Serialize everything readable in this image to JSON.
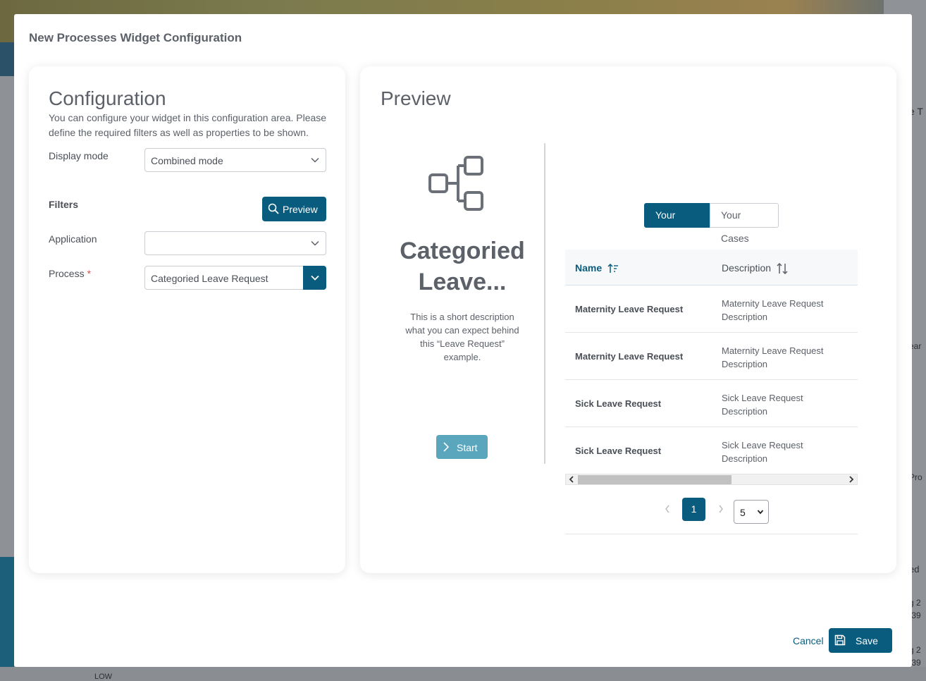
{
  "modal": {
    "title": "New Processes Widget Configuration",
    "cancel_label": "Cancel",
    "save_label": "Save"
  },
  "config": {
    "heading": "Configuration",
    "description": "You can configure your widget in this configuration area. Please define the required filters as well as properties to be shown.",
    "display_mode_label": "Display mode",
    "display_mode_value": "Combined mode",
    "filters_label": "Filters",
    "preview_button": "Preview",
    "application_label": "Application",
    "application_value": "",
    "process_label": "Process",
    "process_required_mark": "*",
    "process_value": "Categoried Leave Request"
  },
  "preview": {
    "heading": "Preview",
    "process_title": "Categoried Leave...",
    "process_description": "This is a short description what you can expect behind this “Leave Request” example.",
    "start_label": "Start",
    "tabs": [
      {
        "label": "Your Tasks",
        "active": true
      },
      {
        "label": "Your Cases",
        "active": false
      }
    ],
    "table": {
      "columns": [
        "Name",
        "Description"
      ],
      "rows": [
        {
          "name": "Maternity Leave Request",
          "description": "Maternity Leave Request Description"
        },
        {
          "name": "Maternity Leave Request",
          "description": "Maternity Leave Request Description"
        },
        {
          "name": "Sick Leave Request",
          "description": "Sick Leave Request Description"
        },
        {
          "name": "Sick Leave Request",
          "description": "Sick Leave Request Description"
        }
      ]
    },
    "pagination": {
      "current_page": "1",
      "page_size": "5"
    }
  },
  "background": {
    "fragments": [
      "e T",
      "ear",
      "Pro",
      "ed",
      "g 2",
      ":39",
      "g 2",
      ":39",
      "LOW"
    ]
  },
  "colors": {
    "primary": "#0a5c7e",
    "start_button": "#5aa6bd"
  }
}
